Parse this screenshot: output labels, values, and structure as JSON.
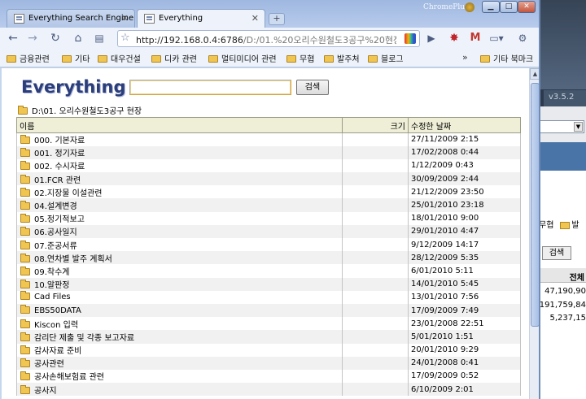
{
  "browser": {
    "tabs": [
      {
        "title": "Everything Search Engine",
        "active": false
      },
      {
        "title": "Everything",
        "active": true
      }
    ],
    "profile_name": "ChromePlus",
    "url_host": "http://192.168.0.4:6786",
    "url_path": "/D:/01.%20오리수원철도3공구%20현장",
    "bookmarks": [
      "금융관련",
      "기타",
      "대우건설",
      "디카 관련",
      "멀티미디어 관련",
      "무협",
      "발주처",
      "블로그"
    ],
    "other_bookmarks": "기타 북마크",
    "more_chevron": "»"
  },
  "page": {
    "logo": "Everything",
    "search_placeholder": "",
    "search_button": "검색",
    "current_path": "D:\\01. 오리수원철도3공구 현장",
    "columns": {
      "name": "이름",
      "size": "크기",
      "date": "수정한 날짜"
    },
    "rows": [
      {
        "name": "000. 기본자료",
        "size": "",
        "date": "27/11/2009 2:15"
      },
      {
        "name": "001. 정기자료",
        "size": "",
        "date": "17/02/2008 0:44"
      },
      {
        "name": "002. 수시자료",
        "size": "",
        "date": "1/12/2009 0:43"
      },
      {
        "name": "01.FCR 관련",
        "size": "",
        "date": "30/09/2009 2:44"
      },
      {
        "name": "02.지장물 이설관련",
        "size": "",
        "date": "21/12/2009 23:50"
      },
      {
        "name": "04.설계변경",
        "size": "",
        "date": "25/01/2010 23:18"
      },
      {
        "name": "05.정기적보고",
        "size": "",
        "date": "18/01/2010 9:00"
      },
      {
        "name": "06.공사일지",
        "size": "",
        "date": "29/01/2010 4:47"
      },
      {
        "name": "07.준공서류",
        "size": "",
        "date": "9/12/2009 14:17"
      },
      {
        "name": "08.연차별 발주 계획서",
        "size": "",
        "date": "28/12/2009 5:35"
      },
      {
        "name": "09.착수계",
        "size": "",
        "date": "6/01/2010 5:11"
      },
      {
        "name": "10.알판정",
        "size": "",
        "date": "14/01/2010 5:45"
      },
      {
        "name": "Cad Files",
        "size": "",
        "date": "13/01/2010 7:56"
      },
      {
        "name": "EBS50DATA",
        "size": "",
        "date": "17/09/2009 7:49"
      },
      {
        "name": "Kiscon 입력",
        "size": "",
        "date": "23/01/2008 22:51"
      },
      {
        "name": "감리단 제출 및 각종 보고자료",
        "size": "",
        "date": "5/01/2010 1:51"
      },
      {
        "name": "감사자료 준비",
        "size": "",
        "date": "20/01/2010 9:29"
      },
      {
        "name": "공사관련",
        "size": "",
        "date": "24/01/2008 0:41"
      },
      {
        "name": "공사손해보험료 관련",
        "size": "",
        "date": "17/09/2009 0:52"
      },
      {
        "name": "공사지",
        "size": "",
        "date": "6/10/2009 2:01"
      }
    ]
  },
  "background_window": {
    "version": "v3.5.2",
    "bookmark_partial_1": "무협",
    "bookmark_partial_2": "발",
    "search_button": "검색",
    "column_header": "전체",
    "values": [
      "47,190,90",
      "191,759,84",
      "5,237,15"
    ]
  }
}
